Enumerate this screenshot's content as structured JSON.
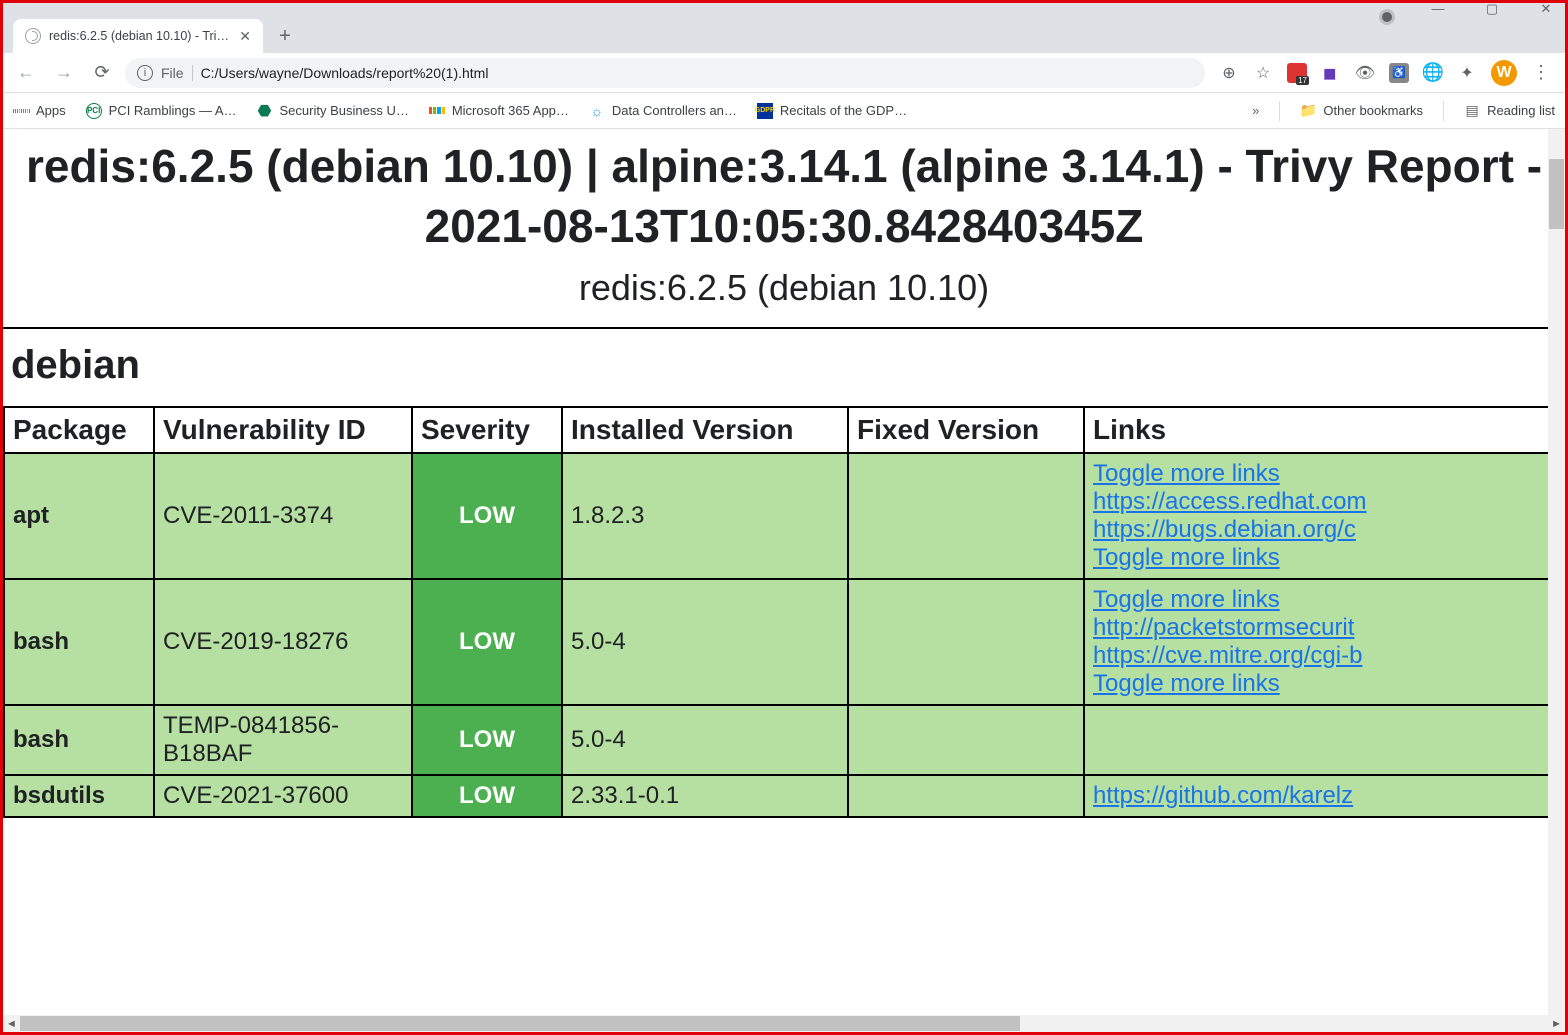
{
  "window": {
    "tab_title": "redis:6.2.5 (debian 10.10) - Trivy R",
    "url_scheme_label": "File",
    "url_path": "C:/Users/wayne/Downloads/report%20(1).html"
  },
  "bookmarks": {
    "apps": "Apps",
    "items": [
      "PCI Ramblings — A…",
      "Security Business U…",
      "Microsoft 365 App…",
      "Data Controllers an…",
      "Recitals of the GDP…"
    ],
    "other": "Other bookmarks",
    "reading": "Reading list"
  },
  "report": {
    "main_title": "redis:6.2.5 (debian 10.10) | alpine:3.14.1 (alpine 3.14.1) - Trivy Report - 2021-08-13T10:05:30.842840345Z",
    "image_title": "redis:6.2.5 (debian 10.10)",
    "type_title": "debian",
    "headers": {
      "package": "Package",
      "vuln_id": "Vulnerability ID",
      "severity": "Severity",
      "installed": "Installed Version",
      "fixed": "Fixed Version",
      "links": "Links"
    },
    "rows": [
      {
        "package": "apt",
        "vuln_id": "CVE-2011-3374",
        "severity": "LOW",
        "installed": "1.8.2.3",
        "fixed": "",
        "links": [
          "Toggle more links",
          "https://access.redhat.com",
          "https://bugs.debian.org/c",
          "Toggle more links"
        ]
      },
      {
        "package": "bash",
        "vuln_id": "CVE-2019-18276",
        "severity": "LOW",
        "installed": "5.0-4",
        "fixed": "",
        "links": [
          "Toggle more links",
          "http://packetstormsecurit",
          "https://cve.mitre.org/cgi-b",
          "Toggle more links"
        ]
      },
      {
        "package": "bash",
        "vuln_id": "TEMP-0841856-B18BAF",
        "severity": "LOW",
        "installed": "5.0-4",
        "fixed": "",
        "links": []
      },
      {
        "package": "bsdutils",
        "vuln_id": "CVE-2021-37600",
        "severity": "LOW",
        "installed": "2.33.1-0.1",
        "fixed": "",
        "links": [
          "https://github.com/karelz"
        ]
      }
    ]
  },
  "avatar_letter": "W"
}
